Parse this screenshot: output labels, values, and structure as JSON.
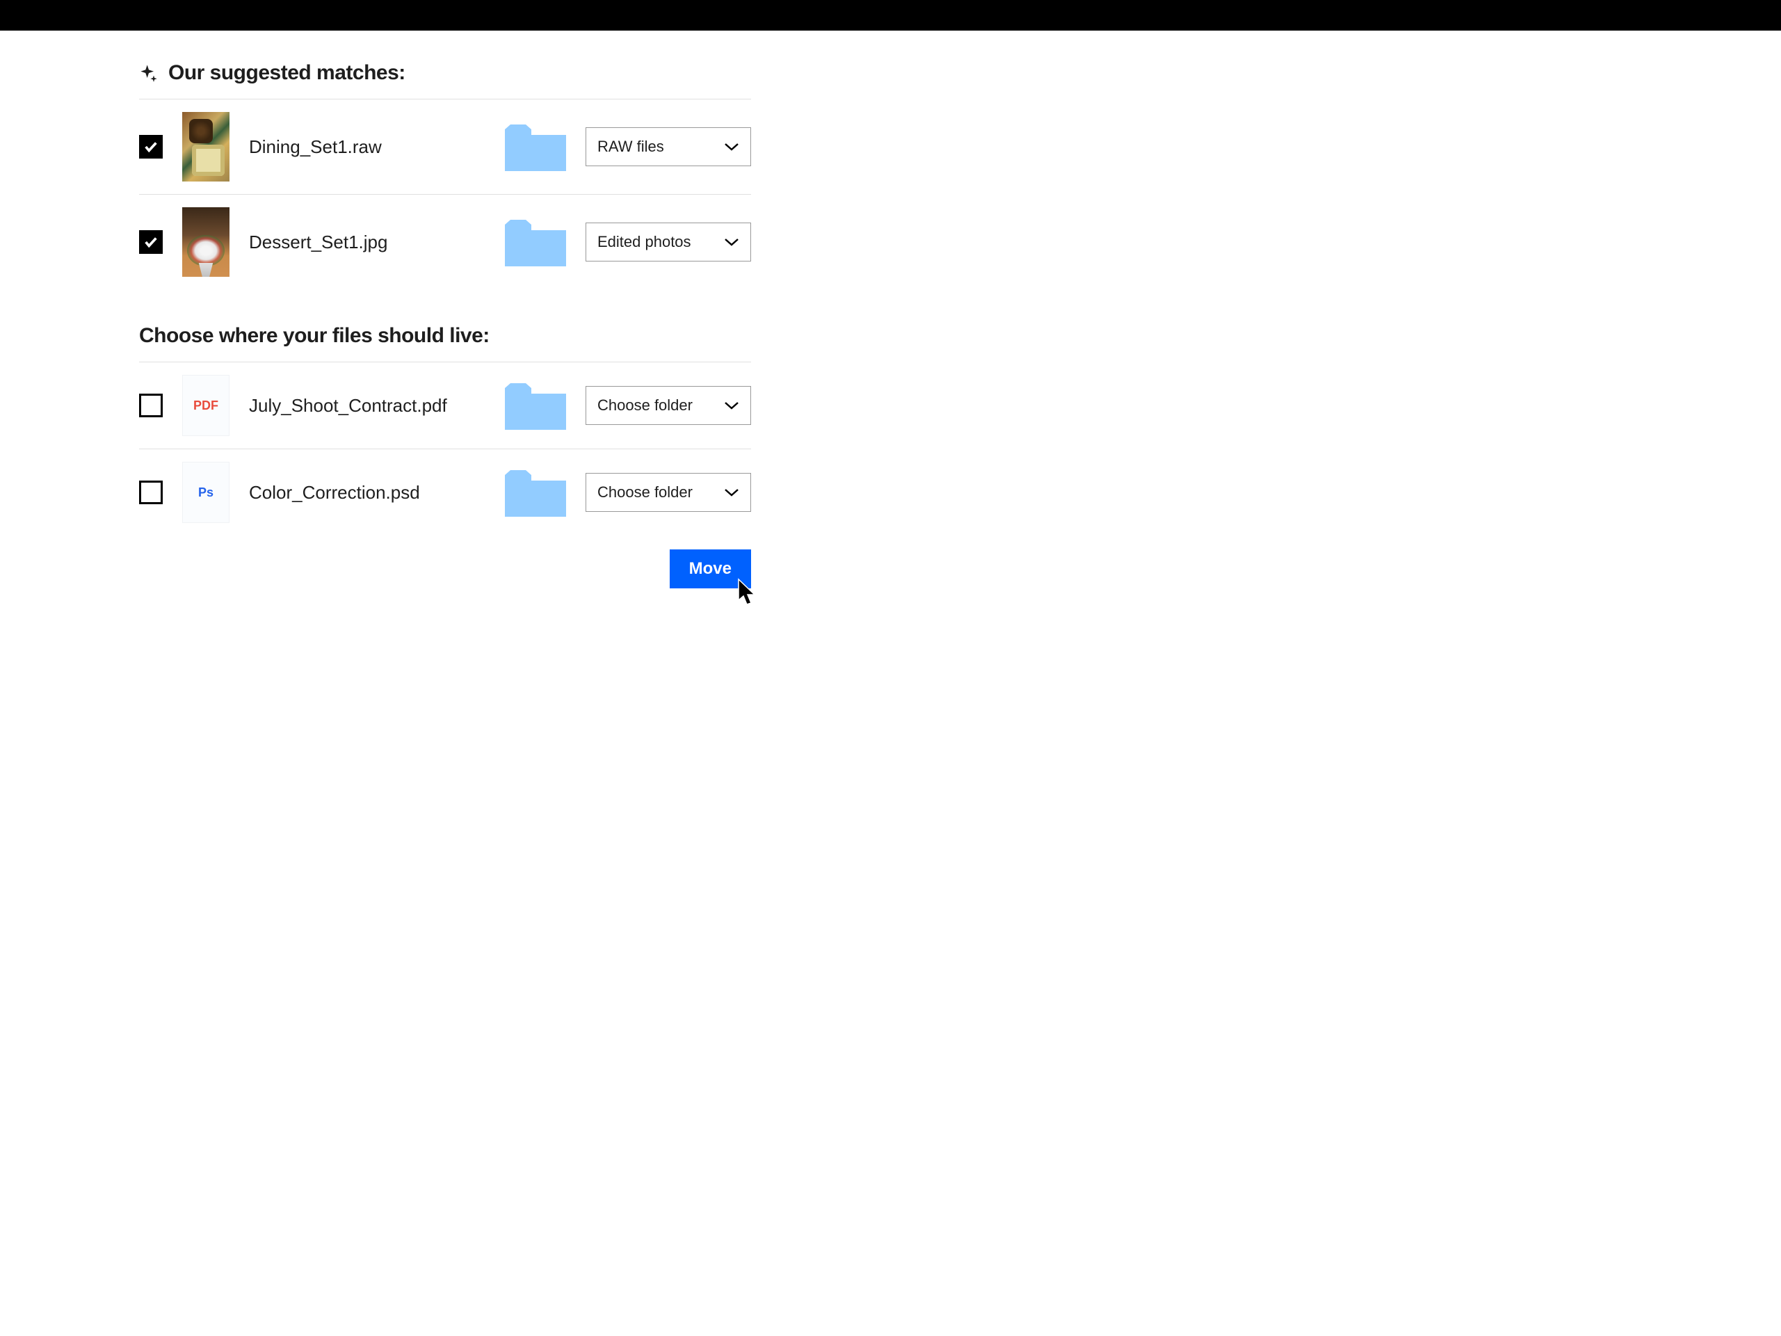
{
  "sections": {
    "suggested": {
      "title": "Our suggested matches:",
      "rows": [
        {
          "checked": true,
          "thumbClass": "thumb-food1",
          "filename": "Dining_Set1.raw",
          "folder": "RAW files"
        },
        {
          "checked": true,
          "thumbClass": "thumb-food2",
          "filename": "Dessert_Set1.jpg",
          "folder": "Edited photos"
        }
      ]
    },
    "choose": {
      "title": "Choose where your files should live:",
      "rows": [
        {
          "checked": false,
          "iconType": "pdf",
          "iconLabel": "PDF",
          "filename": "July_Shoot_Contract.pdf",
          "folder": "Choose folder"
        },
        {
          "checked": false,
          "iconType": "ps",
          "iconLabel": "Ps",
          "filename": "Color_Correction.psd",
          "folder": "Choose folder"
        }
      ]
    }
  },
  "actions": {
    "move_label": "Move"
  }
}
